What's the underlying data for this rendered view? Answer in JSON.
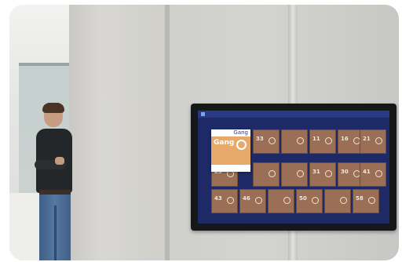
{
  "display": {
    "topbar": {
      "title": "",
      "right_1": "",
      "right_2": ""
    },
    "detail_panel": {
      "header_left": "",
      "header_title": "Gang",
      "room_name": "Gang",
      "subtitle": "",
      "footer_left": "",
      "footer_right": ""
    },
    "tiles": [
      {
        "num": "33"
      },
      {
        "num": "11"
      },
      {
        "num": "16"
      },
      {
        "num": "21"
      },
      {
        "num": "23"
      },
      {
        "num": "31"
      },
      {
        "num": "30"
      },
      {
        "num": "41"
      },
      {
        "num": "43"
      },
      {
        "num": "46"
      },
      {
        "num": "50"
      },
      {
        "num": "58"
      }
    ],
    "brand": ""
  },
  "colors": {
    "screen": "#1e2a66",
    "tile": "#9a6f56",
    "highlight": "#e6a969"
  }
}
